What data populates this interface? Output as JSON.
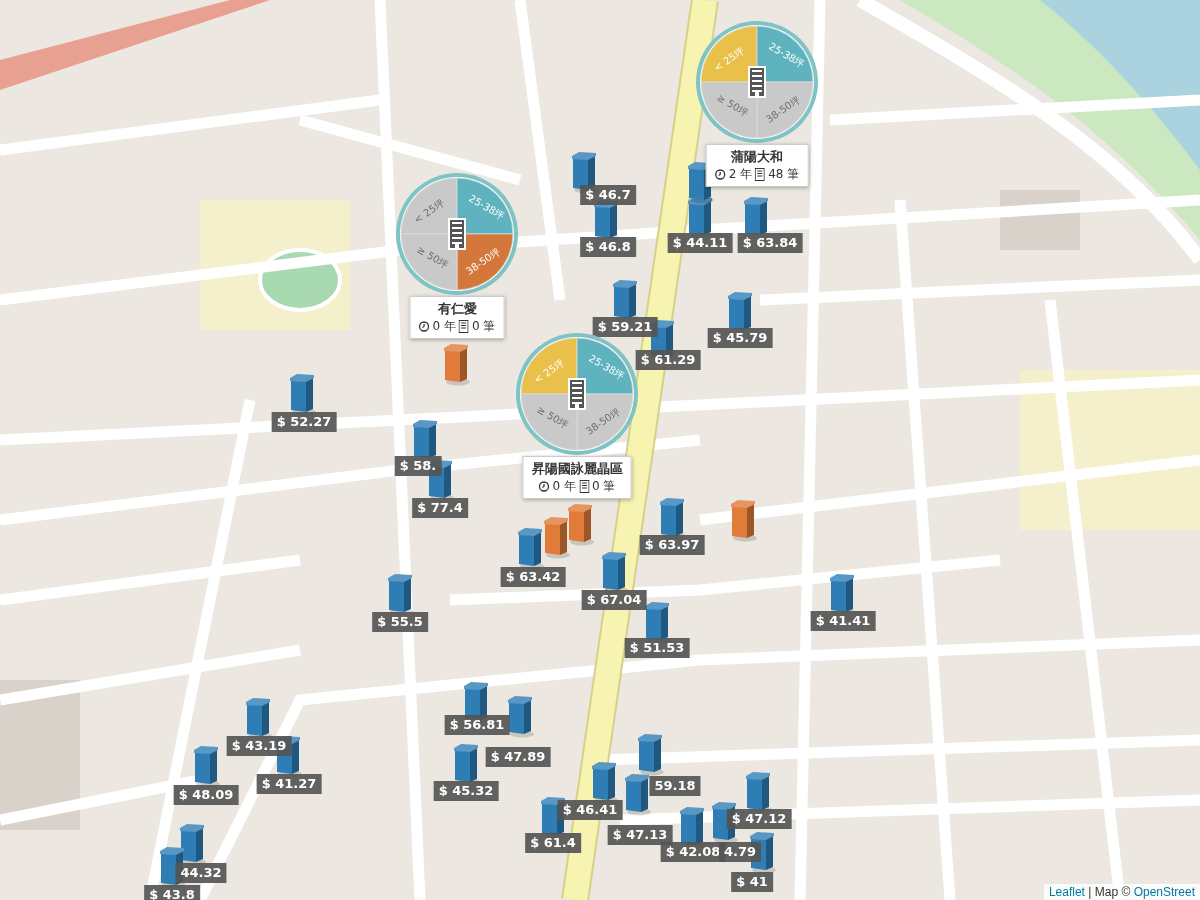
{
  "clusters": [
    {
      "name": "蒲陽大和",
      "age": "2 年",
      "count": "48 筆",
      "segments": [
        {
          "label": "< 25坪",
          "active": true
        },
        {
          "label": "25-38坪",
          "active": true
        },
        {
          "label": "38-50坪",
          "active": false
        },
        {
          "label": "≥ 50坪",
          "active": false
        }
      ]
    },
    {
      "name": "有仁愛",
      "age": "0 年",
      "count": "0 筆",
      "segments": [
        {
          "label": "< 25坪",
          "active": false
        },
        {
          "label": "25-38坪",
          "active": true
        },
        {
          "label": "38-50坪",
          "active": true
        },
        {
          "label": "≥ 50坪",
          "active": false
        }
      ]
    },
    {
      "name": "昇陽國詠麗晶區",
      "age": "0 年",
      "count": "0 筆",
      "segments": [
        {
          "label": "< 25坪",
          "active": true
        },
        {
          "label": "25-38坪",
          "active": true
        },
        {
          "label": "38-50坪",
          "active": false
        },
        {
          "label": "≥ 50坪",
          "active": false
        }
      ]
    }
  ],
  "markers": [
    {
      "price": "$ 46.7",
      "color": "#2f7db5"
    },
    {
      "price": "$ 46.8",
      "color": "#2f7db5"
    },
    {
      "price": "$ 44.11",
      "color": "#2f7db5"
    },
    {
      "price": "$ 63.84",
      "color": "#2f7db5"
    },
    {
      "price": "$ 59.21",
      "color": "#2f7db5"
    },
    {
      "price": "$ 45.79",
      "color": "#2f7db5"
    },
    {
      "price": "$ 61.29",
      "color": "#2f7db5"
    },
    {
      "price": "$ 52.27",
      "color": "#2f7db5"
    },
    {
      "price": "$ 58.",
      "color": "#2f7db5"
    },
    {
      "price": "$ 77.4",
      "color": "#2f7db5"
    },
    {
      "price": "$ 63.97",
      "color": "#2f7db5"
    },
    {
      "price": "$ 63.42",
      "color": "#2f7db5"
    },
    {
      "price": "$ 67.04",
      "color": "#2f7db5"
    },
    {
      "price": "$ 55.5",
      "color": "#2f7db5"
    },
    {
      "price": "$ 41.41",
      "color": "#2f7db5"
    },
    {
      "price": "$ 51.53",
      "color": "#2f7db5"
    },
    {
      "price": "$ 56.81",
      "color": "#2f7db5"
    },
    {
      "price": "$ 43.19",
      "color": "#2f7db5"
    },
    {
      "price": "$ 47.89",
      "color": "#2f7db5"
    },
    {
      "price": "$ 48.09",
      "color": "#2f7db5"
    },
    {
      "price": "$ 41.27",
      "color": "#2f7db5"
    },
    {
      "price": "$ 45.32",
      "color": "#2f7db5"
    },
    {
      "price": "59.18",
      "color": "#2f7db5"
    },
    {
      "price": "$ 46.41",
      "color": "#2f7db5"
    },
    {
      "price": "$ 47.12",
      "color": "#2f7db5"
    },
    {
      "price": "$ 61.4",
      "color": "#2f7db5"
    },
    {
      "price": "$ 47.13",
      "color": "#2f7db5"
    },
    {
      "price": "$ 42.08",
      "color": "#2f7db5"
    },
    {
      "price": "4.79",
      "color": "#2f7db5"
    },
    {
      "price": "44.32",
      "color": "#2f7db5"
    },
    {
      "price": "$ 43.8",
      "color": "#2f7db5"
    },
    {
      "price": "$ 41",
      "color": "#2f7db5"
    },
    {
      "color": "#2f7db5"
    },
    {
      "color": "#e07b39"
    },
    {
      "color": "#e07b39"
    },
    {
      "color": "#e07b39"
    },
    {
      "color": "#e07b39"
    }
  ],
  "attribution": {
    "link": "Leaflet",
    "text": "| Map ©",
    "source": "OpenStreet"
  }
}
